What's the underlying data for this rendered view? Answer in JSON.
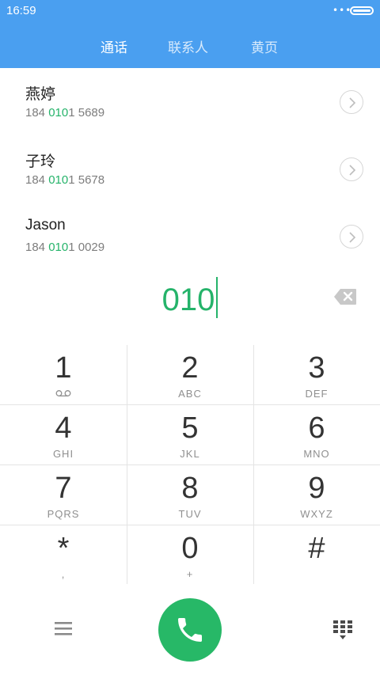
{
  "status_bar": {
    "time": "16:59",
    "dots": "•••"
  },
  "tabs": [
    {
      "label": "通话",
      "active": true
    },
    {
      "label": "联系人",
      "active": false
    },
    {
      "label": "黄页",
      "active": false
    }
  ],
  "contacts": [
    {
      "name": "燕婷",
      "number_prefix": "184 ",
      "number_match": "010",
      "number_suffix": "1 5689"
    },
    {
      "name": "子玲",
      "number_prefix": "184 ",
      "number_match": "010",
      "number_suffix": "1 5678"
    },
    {
      "name": "Jason",
      "number_prefix": "184 ",
      "number_match": "010",
      "number_suffix": "1 0029"
    }
  ],
  "dialer": {
    "input": "010"
  },
  "keypad": [
    {
      "digit": "1",
      "letters": ""
    },
    {
      "digit": "2",
      "letters": "ABC"
    },
    {
      "digit": "3",
      "letters": "DEF"
    },
    {
      "digit": "4",
      "letters": "GHI"
    },
    {
      "digit": "5",
      "letters": "JKL"
    },
    {
      "digit": "6",
      "letters": "MNO"
    },
    {
      "digit": "7",
      "letters": "PQRS"
    },
    {
      "digit": "8",
      "letters": "TUV"
    },
    {
      "digit": "9",
      "letters": "WXYZ"
    },
    {
      "digit": "*",
      "letters": ","
    },
    {
      "digit": "0",
      "letters": "+"
    },
    {
      "digit": "#",
      "letters": ""
    }
  ],
  "colors": {
    "header": "#4a9ff0",
    "accent": "#25b36a",
    "call_button": "#27b867"
  },
  "icons": {
    "voicemail": "voicemail-icon",
    "backspace": "backspace-icon",
    "menu": "menu-icon",
    "call": "phone-icon",
    "dialpad": "dialpad-icon",
    "chevron": "chevron-right-icon"
  }
}
